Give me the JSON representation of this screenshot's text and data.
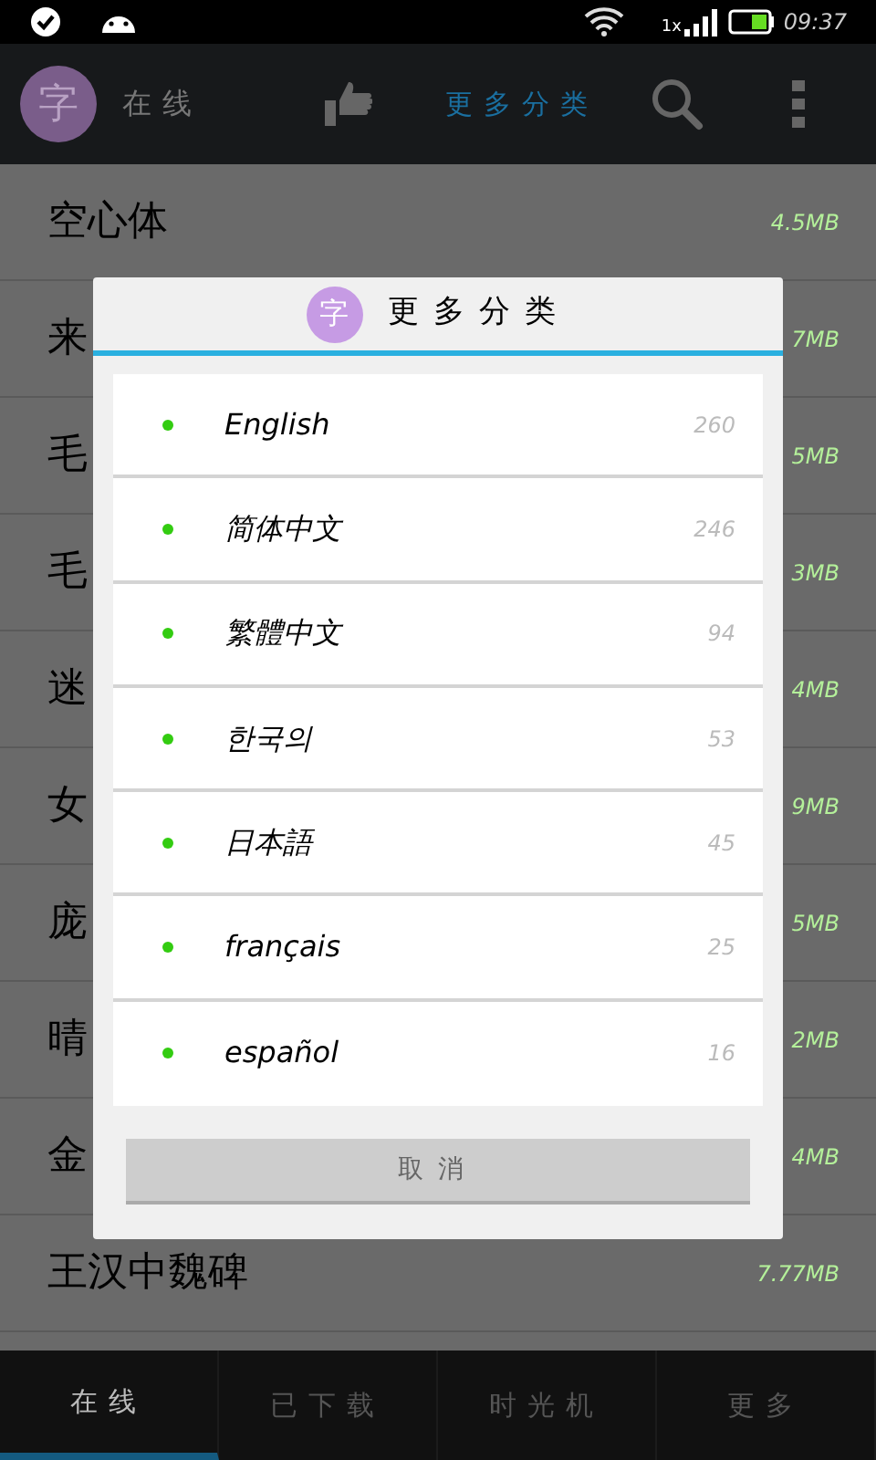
{
  "status_bar": {
    "network": "1x",
    "time": "09:37"
  },
  "toolbar": {
    "avatar": "字",
    "title": "在线",
    "category": "更多分类"
  },
  "fonts": [
    {
      "name": "空心体",
      "size": "4.5MB"
    },
    {
      "name": "来",
      "size": "7MB"
    },
    {
      "name": "毛",
      "size": "5MB"
    },
    {
      "name": "毛",
      "size": "3MB"
    },
    {
      "name": "迷",
      "size": "4MB"
    },
    {
      "name": "女",
      "size": "9MB"
    },
    {
      "name": "庞",
      "size": "5MB"
    },
    {
      "name": "晴",
      "size": "2MB"
    },
    {
      "name": "金",
      "size": "4MB"
    },
    {
      "name": "王汉中魏碑",
      "size": "7.77MB"
    }
  ],
  "dialog": {
    "avatar": "字",
    "title": "更多分类",
    "languages": [
      {
        "name": "English",
        "count": "260",
        "color": "#33cc11"
      },
      {
        "name": "简体中文",
        "count": "246",
        "color": "#33cc11"
      },
      {
        "name": "繁體中文",
        "count": "94",
        "color": "#33cc11"
      },
      {
        "name": "한국의",
        "count": "53",
        "color": "#33cc11"
      },
      {
        "name": "日本語",
        "count": "45",
        "color": "#33cc11"
      },
      {
        "name": "français",
        "count": "25",
        "color": "#33cc11"
      },
      {
        "name": "español",
        "count": "16",
        "color": "#33cc11"
      }
    ],
    "cancel": "取消"
  },
  "bottom_tabs": [
    {
      "label": "在线",
      "selected": true
    },
    {
      "label": "已下载",
      "selected": false
    },
    {
      "label": "时光机",
      "selected": false
    },
    {
      "label": "更多",
      "selected": false
    }
  ]
}
